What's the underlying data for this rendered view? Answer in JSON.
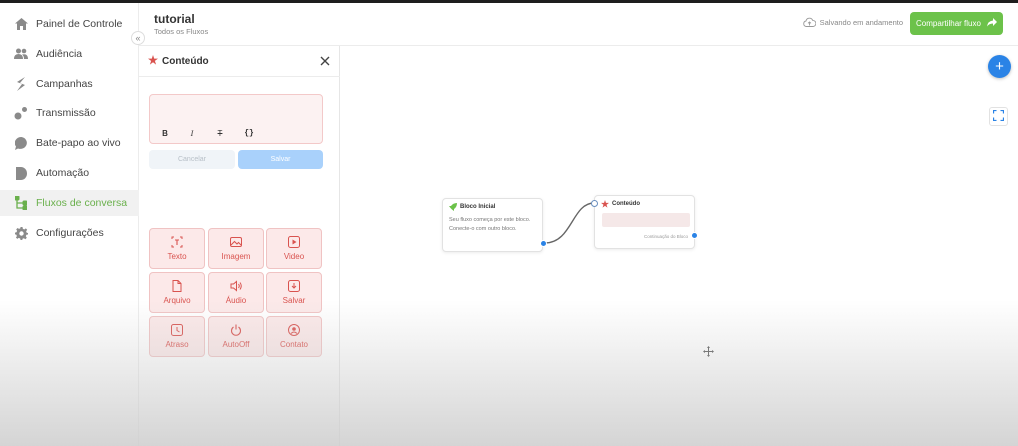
{
  "sidebar": {
    "items": [
      {
        "label": "Painel de Controle",
        "icon": "home-icon",
        "active": false
      },
      {
        "label": "Audiência",
        "icon": "users-icon",
        "active": false
      },
      {
        "label": "Campanhas",
        "icon": "campaign-icon",
        "active": false
      },
      {
        "label": "Transmissão",
        "icon": "broadcast-icon",
        "active": false
      },
      {
        "label": "Bate-papo ao vivo",
        "icon": "chat-bubble-icon",
        "active": false
      },
      {
        "label": "Automação",
        "icon": "automation-icon",
        "active": false
      },
      {
        "label": "Fluxos de conversa",
        "icon": "flow-branch-icon",
        "active": true
      },
      {
        "label": "Configurações",
        "icon": "gear-icon",
        "active": false
      }
    ],
    "collapse_label": "«"
  },
  "header": {
    "title": "tutorial",
    "breadcrumb": "Todos os Fluxos",
    "saving_status": "Salvando em andamento",
    "share_label": "Compartilhar fluxo"
  },
  "panel": {
    "title": "Conteúdo",
    "editor_value": "",
    "format_buttons": [
      "B",
      "I",
      "T",
      "{}"
    ],
    "cancel_label": "Cancelar",
    "save_label": "Salvar",
    "blocks": [
      {
        "label": "Texto",
        "icon": "text-icon"
      },
      {
        "label": "Imagem",
        "icon": "image-icon"
      },
      {
        "label": "Video",
        "icon": "video-icon"
      },
      {
        "label": "Arquivo",
        "icon": "file-icon"
      },
      {
        "label": "Áudio",
        "icon": "audio-icon"
      },
      {
        "label": "Salvar",
        "icon": "download-icon"
      },
      {
        "label": "Atraso",
        "icon": "clock-icon"
      },
      {
        "label": "AutoOff",
        "icon": "power-icon"
      },
      {
        "label": "Contato",
        "icon": "contact-icon"
      }
    ]
  },
  "canvas": {
    "start_node": {
      "title": "Bloco Inicial",
      "description": "Seu fluxo começa por este bloco. Conecte-o com outro bloco."
    },
    "content_node": {
      "title": "Conteúdo",
      "continue_label": "Continuação do Bloco"
    },
    "add_label": "+"
  },
  "colors": {
    "accent_green": "#6cc24a",
    "accent_blue": "#2a83e6",
    "danger_red": "#d9534f"
  }
}
